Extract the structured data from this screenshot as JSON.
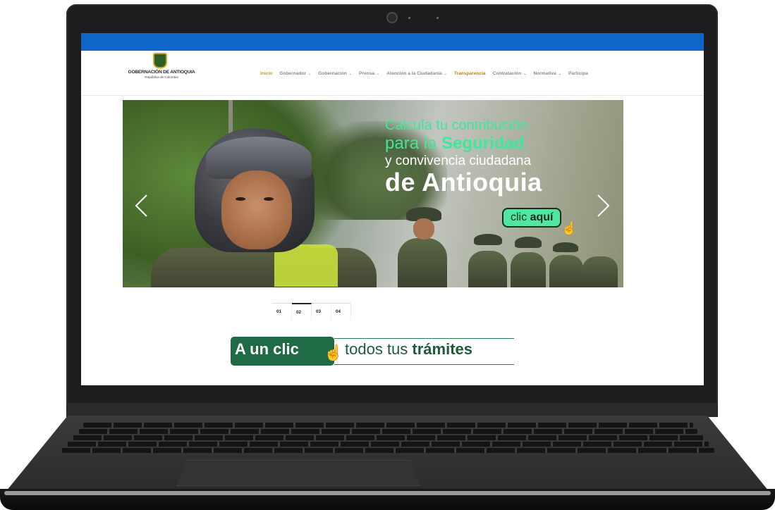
{
  "site": {
    "brand_colors": {
      "top_bar": "#0f66c9",
      "nav_active": "#c79a0e",
      "accent_green": "#3ee89b",
      "promo_green": "#1e6b45"
    },
    "logo": {
      "name": "GOBERNACIÓN DE ANTIOQUIA",
      "subtitle": "República de Colombia",
      "icon": "coat-of-arms-icon"
    }
  },
  "nav": {
    "items": [
      {
        "label": "Inicio",
        "state": "active",
        "has_dropdown": false
      },
      {
        "label": "Gobernador",
        "state": "normal",
        "has_dropdown": true
      },
      {
        "label": "Gobernación",
        "state": "normal",
        "has_dropdown": true
      },
      {
        "label": "Prensa",
        "state": "normal",
        "has_dropdown": true
      },
      {
        "label": "Atención a la Ciudadanía",
        "state": "normal",
        "has_dropdown": true
      },
      {
        "label": "Transparencia",
        "state": "highlight",
        "has_dropdown": false
      },
      {
        "label": "Contratación",
        "state": "normal",
        "has_dropdown": true
      },
      {
        "label": "Normativa",
        "state": "normal",
        "has_dropdown": true
      },
      {
        "label": "Participa",
        "state": "normal",
        "has_dropdown": false
      }
    ]
  },
  "banner": {
    "line1": "Calcula tu contribución",
    "line2_prefix": "para la ",
    "line2_bold": "Seguridad",
    "line3": "y convivencia ciudadana",
    "line4": "de Antioquia",
    "cta_prefix": "clic ",
    "cta_bold": "aquí",
    "prev_icon": "chevron-left-icon",
    "next_icon": "chevron-right-icon"
  },
  "pager": {
    "items": [
      "01",
      "02",
      "03",
      "04"
    ],
    "current_index": 1
  },
  "promo": {
    "left_text": "A un clic",
    "right_prefix": "todos tus ",
    "right_bold": "trámites",
    "icon": "pointer-hand-icon"
  }
}
